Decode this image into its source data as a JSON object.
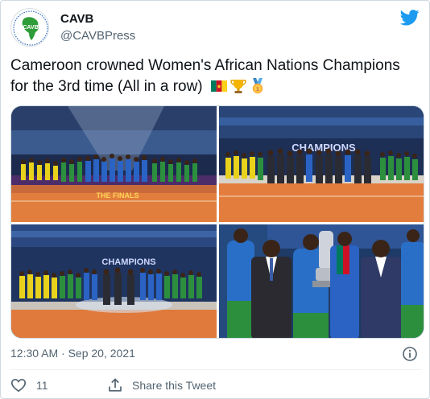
{
  "author": {
    "name": "CAVB",
    "handle": "@CAVBPress"
  },
  "tweet": {
    "text_line1": "Cameroon crowned Women's African Nations Champions",
    "text_line2": "for the 3rd time (All in a row)",
    "emojis": [
      "cameroon-flag",
      "trophy",
      "first-place-medal"
    ]
  },
  "media": {
    "banner_photo1": "THE FINALS",
    "banner_photo2": "CHAMPIONS",
    "banner_photo3": "CHAMPIONS"
  },
  "meta": {
    "timestamp": "12:30 AM · Sep 20, 2021"
  },
  "actions": {
    "like_count": "11",
    "share_label": "Share this Tweet"
  },
  "colors": {
    "twitter_blue": "#1d9bf0",
    "text_primary": "#0f1419",
    "text_secondary": "#536471",
    "border": "#cfd9de"
  }
}
